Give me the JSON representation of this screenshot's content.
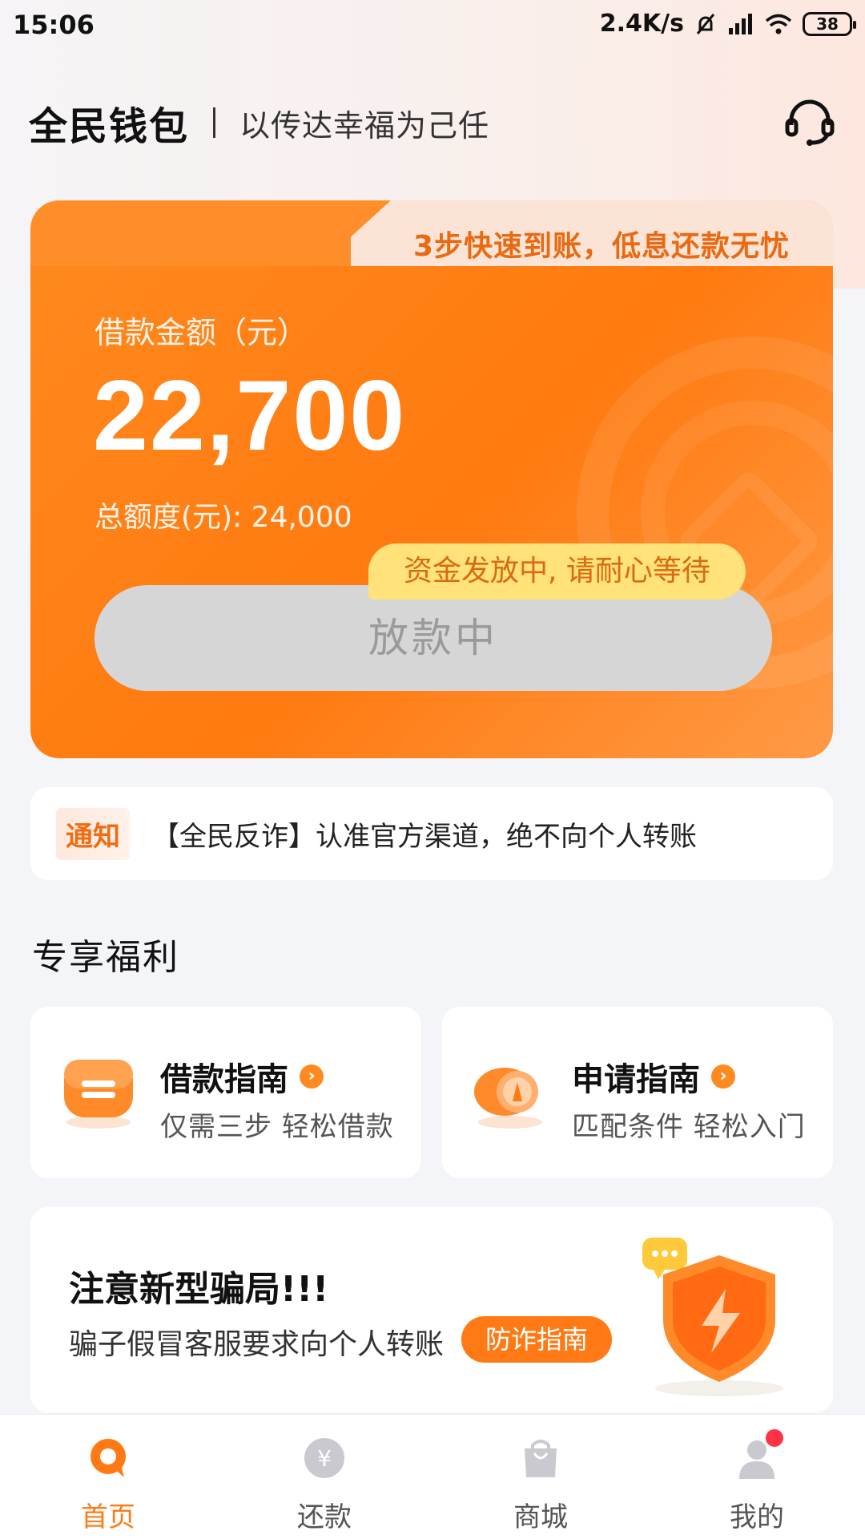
{
  "status_bar": {
    "time": "15:06",
    "net_speed": "2.4K/s",
    "battery": "38"
  },
  "header": {
    "brand": "全民钱包",
    "slogan": "以传达幸福为己任"
  },
  "loan_card": {
    "tab_text": "3步快速到账，低息还款无忧",
    "amount_label": "借款金额（元）",
    "amount": "22,700",
    "total_limit": "总额度(元): 24,000",
    "fund_tip": "资金发放中, 请耐心等待",
    "button_label": "放款中"
  },
  "notice": {
    "tag": "通知",
    "text": "【全民反诈】认准官方渠道，绝不向个人转账"
  },
  "section_title": "专享福利",
  "guides": [
    {
      "title": "借款指南",
      "subtitle": "仅需三步 轻松借款"
    },
    {
      "title": "申请指南",
      "subtitle": "匹配条件 轻松入门"
    }
  ],
  "fraud_card": {
    "title": "注意新型骗局!!!",
    "subtitle": "骗子假冒客服要求向个人转账",
    "button_label": "防诈指南"
  },
  "nav": [
    {
      "label": "首页",
      "icon": "home-icon"
    },
    {
      "label": "还款",
      "icon": "repay-icon"
    },
    {
      "label": "商城",
      "icon": "shop-bag-icon"
    },
    {
      "label": "我的",
      "icon": "profile-icon"
    }
  ],
  "colors": {
    "accent": "#ff7a14",
    "card_orange": "#ff8a1f",
    "tip_yellow": "#ffe27a"
  }
}
